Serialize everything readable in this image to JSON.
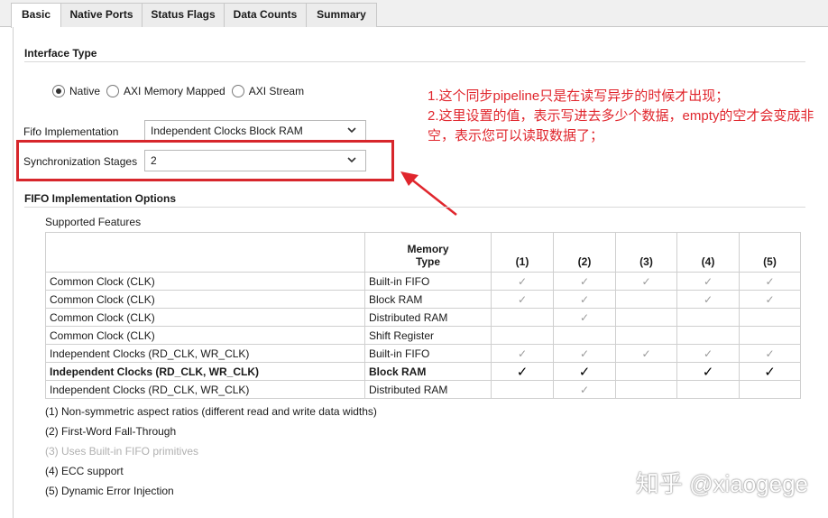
{
  "tabs": [
    {
      "label": "Basic",
      "active": true
    },
    {
      "label": "Native Ports",
      "active": false
    },
    {
      "label": "Status Flags",
      "active": false
    },
    {
      "label": "Data Counts",
      "active": false
    },
    {
      "label": "Summary",
      "active": false
    }
  ],
  "interface_type": {
    "title": "Interface Type",
    "options": [
      {
        "label": "Native",
        "selected": true
      },
      {
        "label": "AXI Memory Mapped",
        "selected": false
      },
      {
        "label": "AXI Stream",
        "selected": false
      }
    ]
  },
  "fifo_implementation": {
    "label": "Fifo Implementation",
    "value": "Independent Clocks Block RAM"
  },
  "sync_stages": {
    "label": "Synchronization Stages",
    "value": "2"
  },
  "annotation": {
    "line1": "1.这个同步pipeline只是在读写异步的时候才出现；",
    "line2": "2.这里设置的值，表示写进去多少个数据，empty的空才会变成非空，表示您可以读取数据了；",
    "color": "#e0262d"
  },
  "options_section": {
    "title": "FIFO Implementation Options",
    "supported_label": "Supported Features",
    "headers": {
      "memory_type_line1": "Memory",
      "memory_type_line2": "Type",
      "cols": [
        "(1)",
        "(2)",
        "(3)",
        "(4)",
        "(5)"
      ]
    },
    "rows": [
      {
        "clock": "Common Clock (CLK)",
        "memory": "Built-in FIFO",
        "checks": [
          true,
          true,
          true,
          true,
          true
        ],
        "bold": false
      },
      {
        "clock": "Common Clock (CLK)",
        "memory": "Block RAM",
        "checks": [
          true,
          true,
          false,
          true,
          true
        ],
        "bold": false
      },
      {
        "clock": "Common Clock (CLK)",
        "memory": "Distributed RAM",
        "checks": [
          false,
          true,
          false,
          false,
          false
        ],
        "bold": false
      },
      {
        "clock": "Common Clock (CLK)",
        "memory": "Shift Register",
        "checks": [
          false,
          false,
          false,
          false,
          false
        ],
        "bold": false
      },
      {
        "clock": "Independent Clocks (RD_CLK, WR_CLK)",
        "memory": "Built-in FIFO",
        "checks": [
          true,
          true,
          true,
          true,
          true
        ],
        "bold": false
      },
      {
        "clock": "Independent Clocks (RD_CLK, WR_CLK)",
        "memory": "Block RAM",
        "checks": [
          true,
          true,
          false,
          true,
          true
        ],
        "bold": true
      },
      {
        "clock": "Independent Clocks (RD_CLK, WR_CLK)",
        "memory": "Distributed RAM",
        "checks": [
          false,
          true,
          false,
          false,
          false
        ],
        "bold": false
      }
    ],
    "notes": [
      {
        "text": "(1) Non-symmetric aspect ratios (different read and write data widths)",
        "dim": false
      },
      {
        "text": "(2) First-Word Fall-Through",
        "dim": false
      },
      {
        "text": "(3) Uses Built-in FIFO primitives",
        "dim": true
      },
      {
        "text": "(4) ECC support",
        "dim": false
      },
      {
        "text": "(5) Dynamic Error Injection",
        "dim": false
      }
    ]
  },
  "watermark": "知乎 @xiaogege"
}
